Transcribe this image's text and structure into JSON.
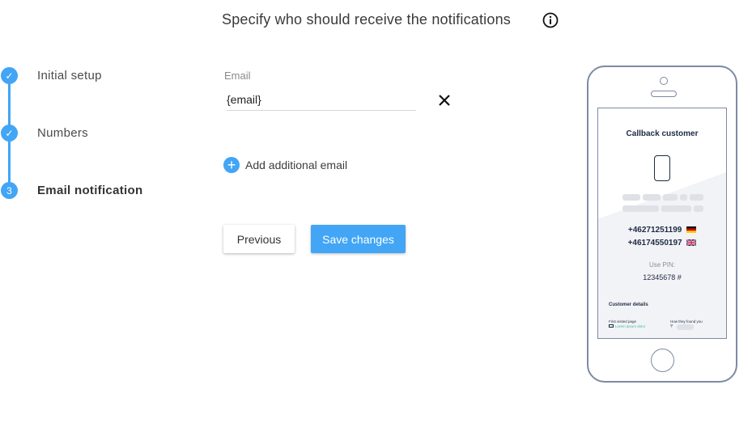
{
  "header": {
    "title": "Specify who should receive the notifications",
    "info_icon": "info-icon"
  },
  "stepper": {
    "steps": [
      {
        "label": "Initial setup",
        "state": "completed",
        "marker": "✓"
      },
      {
        "label": "Numbers",
        "state": "completed",
        "marker": "✓"
      },
      {
        "label": "Email notification",
        "state": "active",
        "marker": "3"
      }
    ],
    "accent_color": "#42a5f5"
  },
  "form": {
    "email_label": "Email",
    "email_value": "{email}",
    "clear_icon": "close-icon",
    "add_email_label": "Add additional email",
    "add_icon": "plus-circle-icon"
  },
  "buttons": {
    "previous": "Previous",
    "save": "Save changes"
  },
  "preview": {
    "title": "Callback customer",
    "numbers": [
      {
        "number": "+46271251199",
        "flag": "de"
      },
      {
        "number": "+46174550197",
        "flag": "gb"
      }
    ],
    "pin_label": "Use PIN:",
    "pin_value": "12345678 #",
    "customer_details_title": "Customer details",
    "first_visited_label": "First visited page",
    "first_visited_value": "Lorem ipsum dolor",
    "how_found_label": "How they found you"
  }
}
